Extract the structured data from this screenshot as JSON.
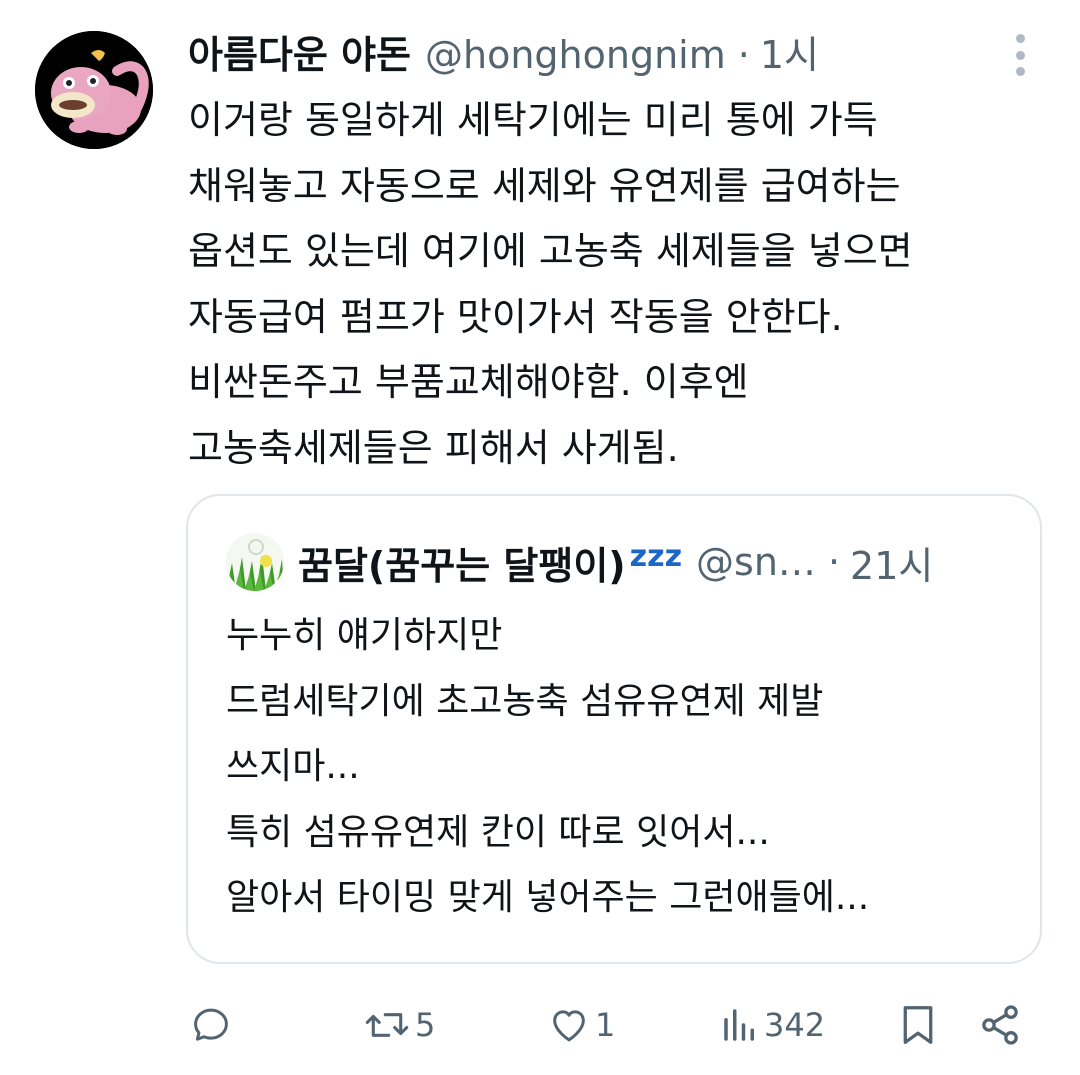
{
  "tweet": {
    "author": {
      "display_name": "아름다운 야돈",
      "handle": "@honghongnim",
      "separator": "·",
      "time": "1시"
    },
    "text_lines": [
      "이거랑 동일하게 세탁기에는 미리 통에 가득",
      "채워놓고 자동으로 세제와 유연제를 급여하는",
      "옵션도 있는데 여기에 고농축 세제들을 넣으면",
      "자동급여 펌프가 맛이가서 작동을 안한다.",
      "비싼돈주고 부품교체해야함. 이후엔",
      "고농축세제들은 피해서 사게됨."
    ]
  },
  "quote": {
    "display_name": "꿈달(꿈꾸는 달팽이)",
    "name_emoji": "zzz",
    "handle": "@sn…",
    "separator": "·",
    "time": "21시",
    "text_lines": [
      "누누히 얘기하지만",
      "드럼세탁기에 초고농축 섬유유연제 제발",
      "쓰지마...",
      "특히 섬유유연제 칸이 따로 잇어서...",
      "알아서 타이밍 맞게 넣어주는 그런애들에..."
    ]
  },
  "actions": {
    "reply": {
      "icon": "reply-icon",
      "count": ""
    },
    "retweet": {
      "icon": "retweet-icon",
      "count": "5"
    },
    "like": {
      "icon": "heart-icon",
      "count": "1"
    },
    "views": {
      "icon": "views-icon",
      "count": "342"
    },
    "bookmark": {
      "icon": "bookmark-icon"
    },
    "share": {
      "icon": "share-icon"
    }
  },
  "colors": {
    "text": "#0f1419",
    "secondary": "#536471",
    "border": "#dfe5ea",
    "avatar_pink": "#e8a2be",
    "zzz_blue": "#1d66c9"
  }
}
